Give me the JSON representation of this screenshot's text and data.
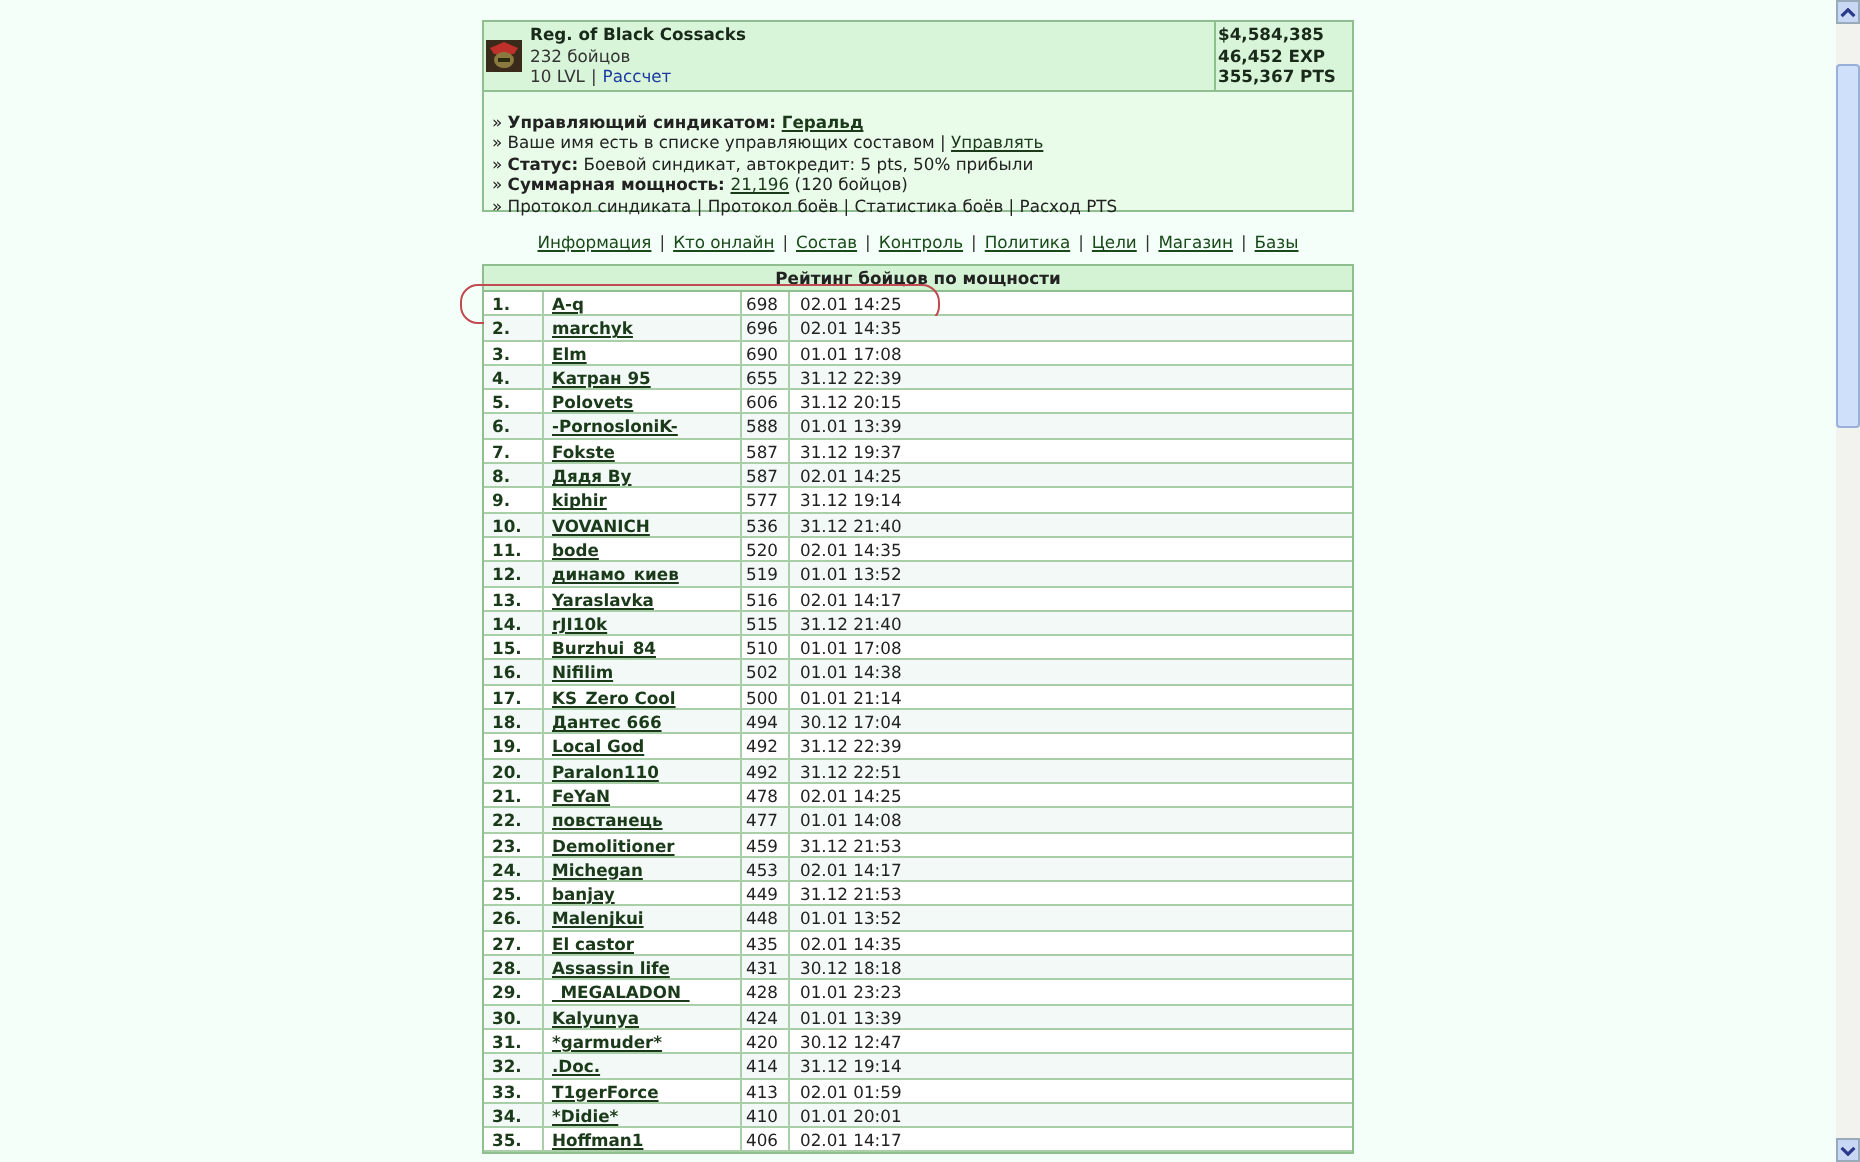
{
  "syndicate": {
    "name": "Reg. of Black Cossacks",
    "members": "232 бойцов",
    "level": "10 LVL",
    "separator": "|",
    "calc_link": "Рассчет",
    "stats": [
      "$4,584,385",
      "46,452 EXP",
      "355,367 PTS"
    ]
  },
  "info_lines": [
    [
      {
        "kind": "plain",
        "text": "» "
      },
      {
        "kind": "bold",
        "text": "Управляющий синдикатом: "
      },
      {
        "kind": "boldlink",
        "text": "Геральд"
      }
    ],
    [
      {
        "kind": "plain",
        "text": "» Ваше имя есть в списке управляющих составом | "
      },
      {
        "kind": "link",
        "text": "Управлять"
      }
    ],
    [
      {
        "kind": "plain",
        "text": "» "
      },
      {
        "kind": "bold",
        "text": "Статус:"
      },
      {
        "kind": "plain",
        "text": " Боевой синдикат, автокредит: 5 pts, 50% прибыли"
      }
    ],
    [
      {
        "kind": "plain",
        "text": "» "
      },
      {
        "kind": "bold",
        "text": "Суммарная мощность: "
      },
      {
        "kind": "link",
        "text": "21,196"
      },
      {
        "kind": "plain",
        "text": " (120 бойцов)"
      }
    ],
    [
      {
        "kind": "plain",
        "text": "» Протокол синдиката | Протокол боёв | Статистика боёв | Расход PTS"
      }
    ]
  ],
  "nav": [
    {
      "kind": "link",
      "text": "Информация"
    },
    {
      "kind": "sep",
      "text": "|"
    },
    {
      "kind": "link",
      "text": "Кто онлайн"
    },
    {
      "kind": "sep",
      "text": "|"
    },
    {
      "kind": "link",
      "text": "Состав"
    },
    {
      "kind": "sep",
      "text": "|"
    },
    {
      "kind": "link",
      "text": "Контроль"
    },
    {
      "kind": "sep",
      "text": "|"
    },
    {
      "kind": "link",
      "text": "Политика"
    },
    {
      "kind": "sep",
      "text": "|"
    },
    {
      "kind": "link",
      "text": "Цели"
    },
    {
      "kind": "sep",
      "text": "|"
    },
    {
      "kind": "link",
      "text": "Магазин"
    },
    {
      "kind": "sep",
      "text": "|"
    },
    {
      "kind": "link",
      "text": "Базы"
    }
  ],
  "table": {
    "title": "Рейтинг бойцов по мощности",
    "rows": [
      {
        "rank": "1.",
        "name": "A-q",
        "power": "698",
        "time": "02.01 14:25",
        "circled": true
      },
      {
        "rank": "2.",
        "name": "marchyk",
        "power": "696",
        "time": "02.01 14:35",
        "circled": false
      },
      {
        "rank": "3.",
        "name": "Elm",
        "power": "690",
        "time": "01.01 17:08",
        "circled": false
      },
      {
        "rank": "4.",
        "name": "Катран 95",
        "power": "655",
        "time": "31.12 22:39",
        "circled": false
      },
      {
        "rank": "5.",
        "name": "Polovets",
        "power": "606",
        "time": "31.12 20:15",
        "circled": false
      },
      {
        "rank": "6.",
        "name": "-PornosloniK-",
        "power": "588",
        "time": "01.01 13:39",
        "circled": false
      },
      {
        "rank": "7.",
        "name": "Fokste",
        "power": "587",
        "time": "31.12 19:37",
        "circled": false
      },
      {
        "rank": "8.",
        "name": "Дядя Ву",
        "power": "587",
        "time": "02.01 14:25",
        "circled": false
      },
      {
        "rank": "9.",
        "name": "kiphir",
        "power": "577",
        "time": "31.12 19:14",
        "circled": false
      },
      {
        "rank": "10.",
        "name": "VOVANICH",
        "power": "536",
        "time": "31.12 21:40",
        "circled": false
      },
      {
        "rank": "11.",
        "name": "bode",
        "power": "520",
        "time": "02.01 14:35",
        "circled": false
      },
      {
        "rank": "12.",
        "name": "динамо_киев",
        "power": "519",
        "time": "01.01 13:52",
        "circled": false
      },
      {
        "rank": "13.",
        "name": "Yaraslavka",
        "power": "516",
        "time": "02.01 14:17",
        "circled": false
      },
      {
        "rank": "14.",
        "name": "rJI10k",
        "power": "515",
        "time": "31.12 21:40",
        "circled": false
      },
      {
        "rank": "15.",
        "name": "Burzhui_84",
        "power": "510",
        "time": "01.01 17:08",
        "circled": false
      },
      {
        "rank": "16.",
        "name": "Nifilim",
        "power": "502",
        "time": "01.01 14:38",
        "circled": false
      },
      {
        "rank": "17.",
        "name": "KS_Zero Cool",
        "power": "500",
        "time": "01.01 21:14",
        "circled": false
      },
      {
        "rank": "18.",
        "name": "Дантес 666",
        "power": "494",
        "time": "30.12 17:04",
        "circled": false
      },
      {
        "rank": "19.",
        "name": "Local God",
        "power": "492",
        "time": "31.12 22:39",
        "circled": false
      },
      {
        "rank": "20.",
        "name": "Paralon110",
        "power": "492",
        "time": "31.12 22:51",
        "circled": false
      },
      {
        "rank": "21.",
        "name": "FeYaN",
        "power": "478",
        "time": "02.01 14:25",
        "circled": false
      },
      {
        "rank": "22.",
        "name": "повстанець",
        "power": "477",
        "time": "01.01 14:08",
        "circled": false
      },
      {
        "rank": "23.",
        "name": "Demolitioner",
        "power": "459",
        "time": "31.12 21:53",
        "circled": false
      },
      {
        "rank": "24.",
        "name": "Michegan",
        "power": "453",
        "time": "02.01 14:17",
        "circled": false
      },
      {
        "rank": "25.",
        "name": "banjay",
        "power": "449",
        "time": "31.12 21:53",
        "circled": false
      },
      {
        "rank": "26.",
        "name": "Malenjkui",
        "power": "448",
        "time": "01.01 13:52",
        "circled": false
      },
      {
        "rank": "27.",
        "name": "El castor",
        "power": "435",
        "time": "02.01 14:35",
        "circled": false
      },
      {
        "rank": "28.",
        "name": "Assassin life",
        "power": "431",
        "time": "30.12 18:18",
        "circled": false
      },
      {
        "rank": "29.",
        "name": "_MEGALADON_",
        "power": "428",
        "time": "01.01 23:23",
        "circled": false
      },
      {
        "rank": "30.",
        "name": "Kalyunya",
        "power": "424",
        "time": "01.01 13:39",
        "circled": false
      },
      {
        "rank": "31.",
        "name": "*garmuder*",
        "power": "420",
        "time": "30.12 12:47",
        "circled": false
      },
      {
        "rank": "32.",
        "name": ".Doc.",
        "power": "414",
        "time": "31.12 19:14",
        "circled": false
      },
      {
        "rank": "33.",
        "name": "T1gerForce",
        "power": "413",
        "time": "02.01 01:59",
        "circled": false
      },
      {
        "rank": "34.",
        "name": "*Didie*",
        "power": "410",
        "time": "01.01 20:01",
        "circled": false
      },
      {
        "rank": "35.",
        "name": "Hoffman1",
        "power": "406",
        "time": "02.01 14:17",
        "circled": false
      }
    ]
  }
}
